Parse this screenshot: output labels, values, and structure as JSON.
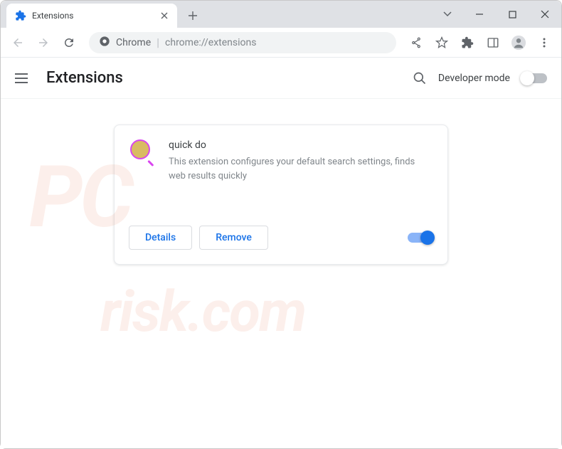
{
  "window": {
    "tab_title": "Extensions"
  },
  "omnibox": {
    "chrome_label": "Chrome",
    "url": "chrome://extensions"
  },
  "header": {
    "title": "Extensions",
    "dev_mode_label": "Developer mode"
  },
  "extension": {
    "name": "quick do",
    "description": "This extension configures your default search settings, finds web results quickly",
    "details_label": "Details",
    "remove_label": "Remove"
  }
}
